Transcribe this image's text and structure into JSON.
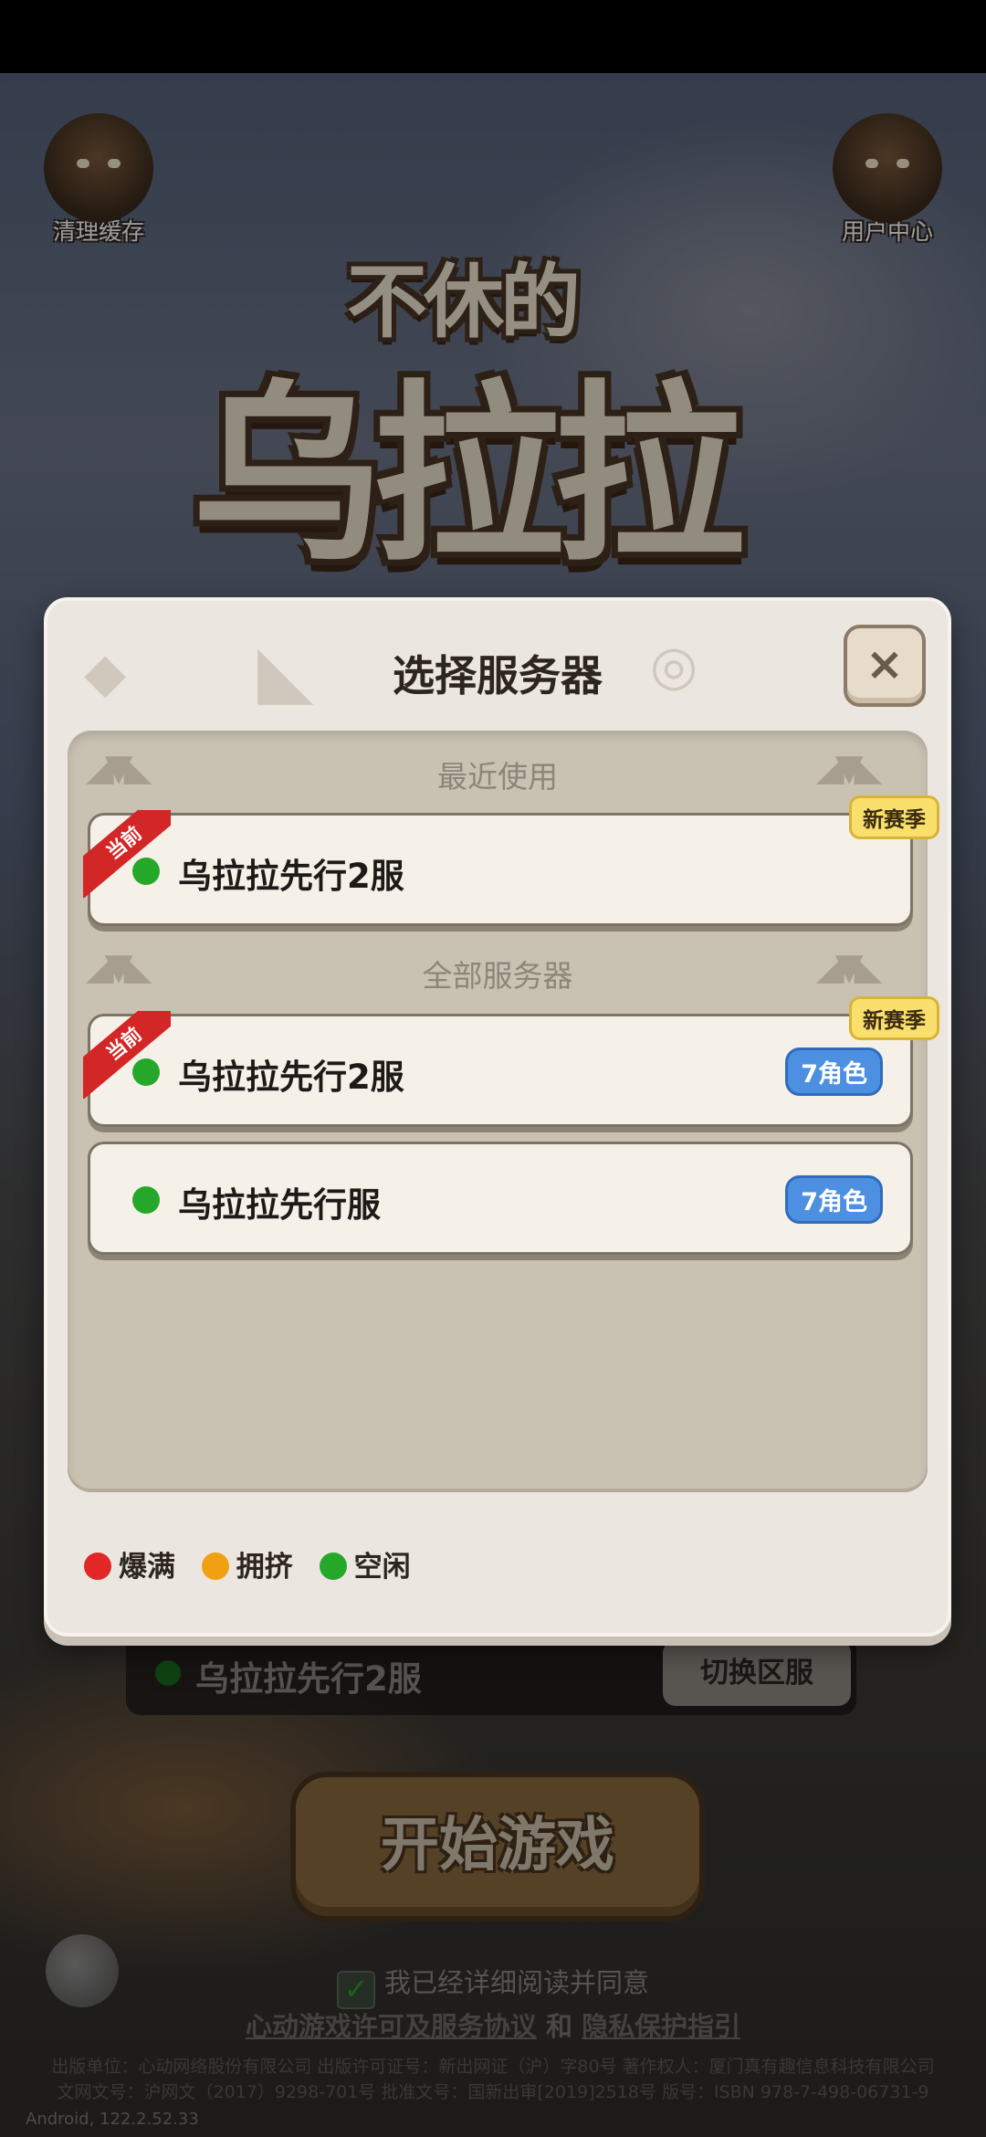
{
  "corner": {
    "left_label": "清理缓存",
    "right_label": "用户中心"
  },
  "logo": {
    "small": "不休的",
    "big": "乌拉拉"
  },
  "dialog": {
    "title": "选择服务器",
    "close_symbol": "×",
    "recent": {
      "header": "最近使用",
      "servers": [
        {
          "name": "乌拉拉先行2服",
          "status": "空闲",
          "current_tag": "当前",
          "season_badge": "新赛季"
        }
      ]
    },
    "all": {
      "header": "全部服务器",
      "servers": [
        {
          "name": "乌拉拉先行2服",
          "status": "空闲",
          "current_tag": "当前",
          "season_badge": "新赛季",
          "roles_badge": "7角色"
        },
        {
          "name": "乌拉拉先行服",
          "status": "空闲",
          "roles_badge": "7角色"
        }
      ]
    },
    "legend": [
      {
        "label": "爆满",
        "color": "#e32626"
      },
      {
        "label": "拥挤",
        "color": "#f0a010"
      },
      {
        "label": "空闲",
        "color": "#25a82a"
      }
    ]
  },
  "bottom": {
    "selected_server": "乌拉拉先行2服",
    "switch_label": "切换区服",
    "start_label": "开始游戏",
    "agree_text": "我已经详细阅读并同意",
    "link1": "心动游戏许可及服务协议",
    "and_text": "和",
    "link2": "隐私保护指引",
    "fine1": "出版单位：心动网络股份有限公司 出版许可证号：新出网证（沪）字80号 著作权人：厦门真有趣信息科技有限公司",
    "fine2": "文网文号：沪网文（2017）9298-701号 批准文号：国新出审[2019]2518号 版号：ISBN 978-7-498-06731-9",
    "version": "Android, 122.2.52.33"
  },
  "colors": {
    "online": "#25a82a",
    "ribbon": "#d32626",
    "season_badge": "#f9df6b",
    "roles_badge": "#4d8fe0"
  }
}
